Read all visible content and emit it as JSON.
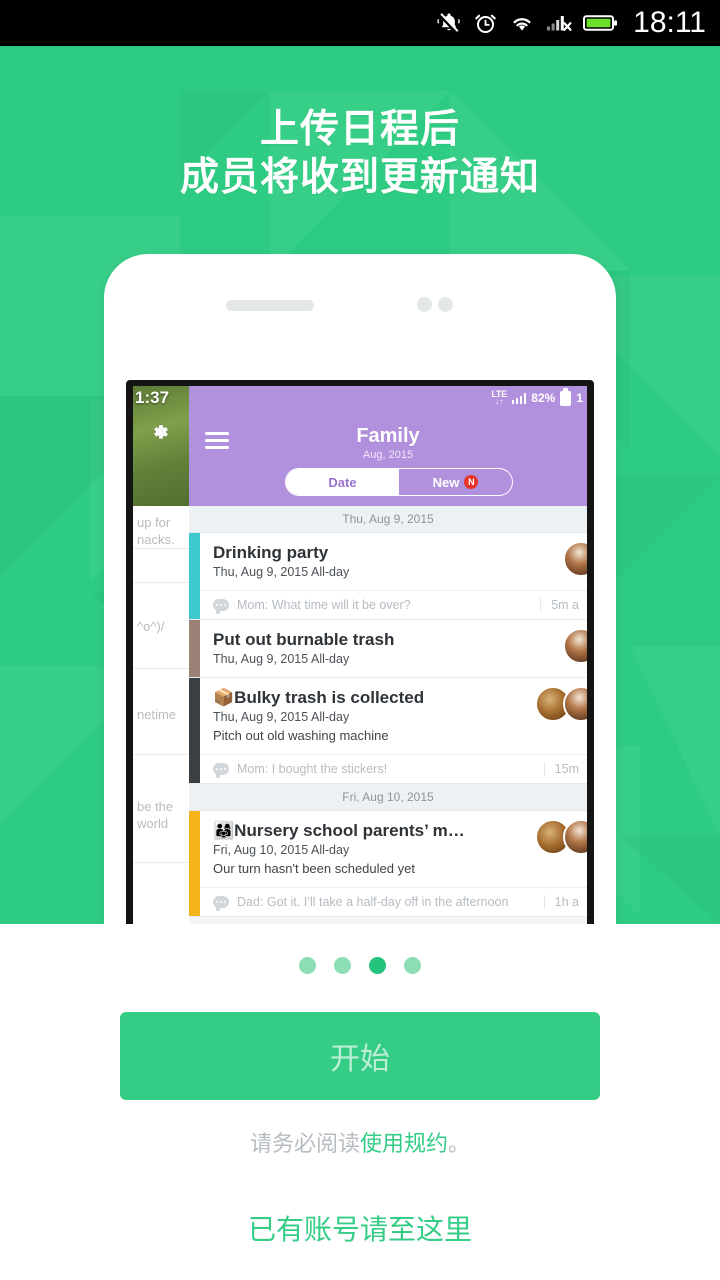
{
  "status_bar": {
    "time": "18:11",
    "icons": [
      "silent-bell-icon",
      "alarm-clock-icon",
      "wifi-icon",
      "signal-off-icon",
      "battery-icon"
    ]
  },
  "hero": {
    "title_line1": "上传日程后",
    "title_line2": "成员将收到更新通知",
    "bg_color": "#2ecc82"
  },
  "phone_screen": {
    "app_status": {
      "network_label": "LTE",
      "network_arrows": "↓↑",
      "battery_percent": "82%",
      "clock": "1"
    },
    "header": {
      "menu_icon": "hamburger-icon",
      "title": "Family",
      "subtitle": "Aug, 2015",
      "tab_date": "Date",
      "tab_new": "New",
      "new_badge": "N"
    },
    "undercard": {
      "line1": "up for",
      "line2": "nacks.",
      "line3": "^o^)/",
      "line4": "netime",
      "line5": "be the",
      "line6": "world"
    },
    "sections": [
      {
        "date_label": "Thu, Aug 9, 2015",
        "events": [
          {
            "bar_color": "#3dc8d0",
            "title": "Drinking party",
            "meta": "Thu, Aug 9, 2015 All-day",
            "desc": "",
            "comment": "Mom: What time will it be over?",
            "comment_time": "5m a"
          },
          {
            "bar_color": "#9a8075",
            "title": "Put out burnable trash",
            "meta": "Thu, Aug 9, 2015 All-day",
            "desc": "",
            "comment": "",
            "comment_time": ""
          },
          {
            "bar_color": "#3a3f44",
            "title": "📦Bulky trash is collected",
            "meta": "Thu, Aug 9, 2015 All-day",
            "desc": "Pitch out old washing machine",
            "comment": "Mom: I bought the stickers!",
            "comment_time": "15m"
          }
        ]
      },
      {
        "date_label": "Fri, Aug 10, 2015",
        "events": [
          {
            "bar_color": "#f5b31c",
            "title": "👨‍👩‍👧Nursery school parents’ m…",
            "meta": "Fri, Aug 10, 2015 All-day",
            "desc": "Our turn hasn't been scheduled yet",
            "comment": "Dad: Got it. I’ll take a half-day off in the afternoon",
            "comment_time": "1h a"
          }
        ]
      }
    ],
    "overlay_clock": "1:37"
  },
  "pagination": {
    "total": 4,
    "active_index": 2
  },
  "footer": {
    "cta_label": "开始",
    "terms_prefix": "请务必阅读",
    "terms_link": "使用规约",
    "terms_suffix": "。",
    "signin_label": "已有账号请至这里",
    "accent_color": "#35cd86"
  }
}
